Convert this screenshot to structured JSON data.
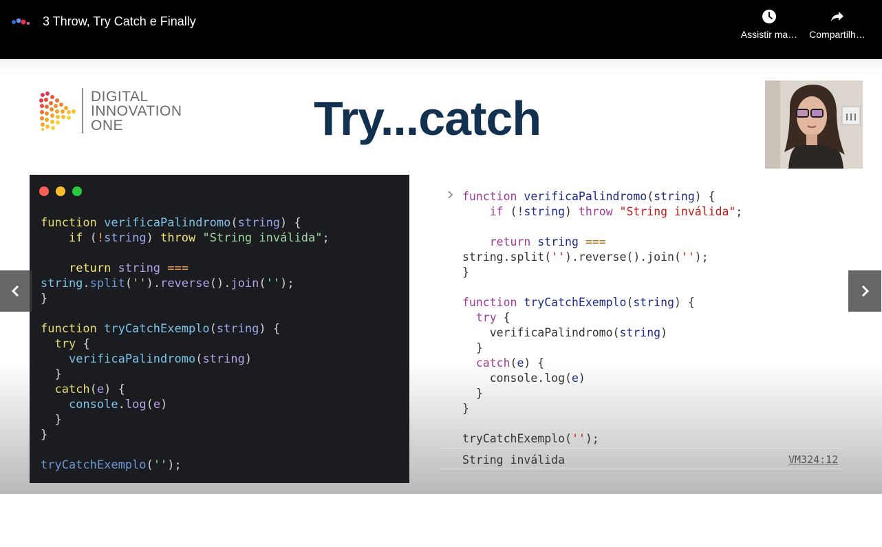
{
  "video": {
    "title": "3 Throw, Try Catch e Finally",
    "actions": [
      {
        "label": "Assistir ma…",
        "icon": "clock-icon"
      },
      {
        "label": "Compartilh…",
        "icon": "share-icon"
      }
    ]
  },
  "slide": {
    "brand": {
      "line1": "DIGITAL",
      "line2": "INNOVATION",
      "line3": "ONE"
    },
    "heading": "Try...catch",
    "editor": {
      "traffic_lights": [
        "#ff5f57",
        "#febc2e",
        "#28c840"
      ]
    },
    "console": {
      "result": "String inválida",
      "source": "VM324:12"
    }
  },
  "navigation": {
    "prev_icon": "chevron-left-icon",
    "next_icon": "chevron-right-icon"
  },
  "colors": {
    "topbar": "#000000",
    "heading": "#12304f",
    "editor_bg": "#1b1c20"
  }
}
